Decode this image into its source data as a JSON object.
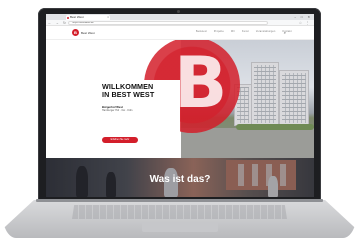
{
  "browser": {
    "tab_title": "Best West",
    "url": "https://bestwest.de",
    "window_controls": "– □ ✕",
    "nav_icons": "← → ↻",
    "toolbar_icons": "☆ ⋮"
  },
  "site": {
    "logo_mark": "B",
    "logo_text": "Best West",
    "nav": [
      "Bestwest",
      "Projekte",
      "Wir",
      "Kunst",
      "Veranstaltungen",
      "Kontakt"
    ],
    "accent_color": "#d31e2a"
  },
  "hero": {
    "title": "WILLKOMMEN\nIN BEST WEST",
    "big_glyph": "B",
    "subtitle": "Bürgerhof West",
    "address": "Hamburger Hof · 3xx · Köln",
    "button_label": "Erfahren Sie mehr"
  },
  "section2": {
    "title": "Was ist das?"
  }
}
